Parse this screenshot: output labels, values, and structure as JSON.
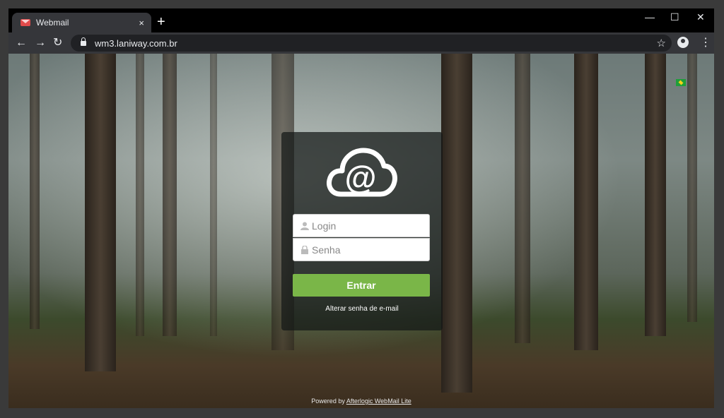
{
  "browser": {
    "tab_title": "Webmail",
    "tab_close": "×",
    "new_tab": "+",
    "window_controls": {
      "minimize": "—",
      "maximize": "☐",
      "close": "✕"
    },
    "nav": {
      "back": "←",
      "forward": "→",
      "reload": "↻"
    },
    "url": "wm3.laniway.com.br",
    "bookmark_star": "☆",
    "menu": "⋮"
  },
  "login": {
    "login_placeholder": "Login",
    "password_placeholder": "Senha",
    "submit_label": "Entrar",
    "change_password_link": "Alterar senha de e-mail"
  },
  "footer": {
    "prefix": "Powered by ",
    "link": "Afterlogic WebMail Lite"
  },
  "icons": {
    "favicon": "mail-icon",
    "logo": "cloud-at-logo",
    "login_field": "user-icon",
    "password_field": "lock-icon",
    "language": "brazil-flag-icon"
  },
  "colors": {
    "submit": "#7ab648",
    "login_panel": "rgba(20,24,22,0.72)"
  }
}
